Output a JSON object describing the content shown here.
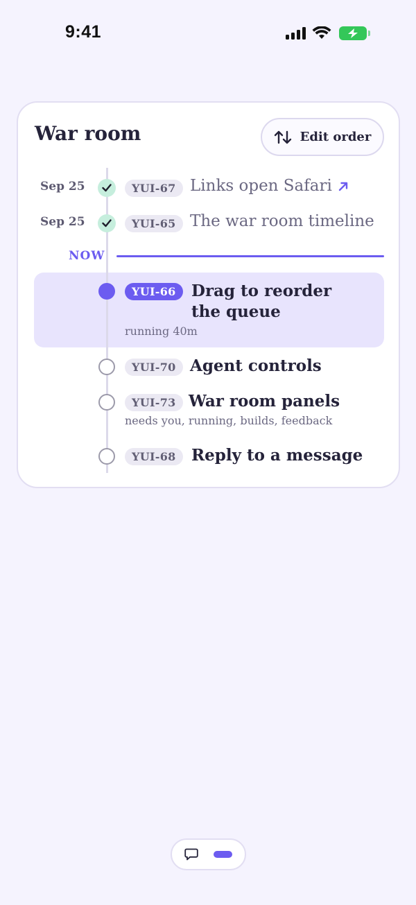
{
  "status_bar": {
    "time": "9:41"
  },
  "card": {
    "title": "War room",
    "edit_button_label": "Edit order",
    "now_label": "NOW",
    "done": [
      {
        "date": "Sep 25",
        "ticket": "YUI-67",
        "title": "Links open Safari",
        "has_link_icon": true
      },
      {
        "date": "Sep 25",
        "ticket": "YUI-65",
        "title": "The war room timeline"
      }
    ],
    "active": {
      "ticket": "YUI-66",
      "title_line1": "Drag to reorder",
      "title_line2": "the queue",
      "subtitle": "running 40m"
    },
    "queue": [
      {
        "ticket": "YUI-70",
        "title": "Agent controls"
      },
      {
        "ticket": "YUI-73",
        "title": "War room panels",
        "subtitle": "needs you, running, builds, feedback"
      },
      {
        "ticket": "YUI-68",
        "title": "Reply to a message"
      }
    ]
  },
  "colors": {
    "accent": "#6c5cf0",
    "background": "#f5f3fe",
    "done_dot": "#c6eedd",
    "battery": "#34c759"
  },
  "icons": {
    "edit_order": "swap-vertical-arrows-icon",
    "done": "checkmark-icon",
    "link": "arrow-up-right-icon",
    "bottom_bar": "chat-bubble-icon"
  }
}
